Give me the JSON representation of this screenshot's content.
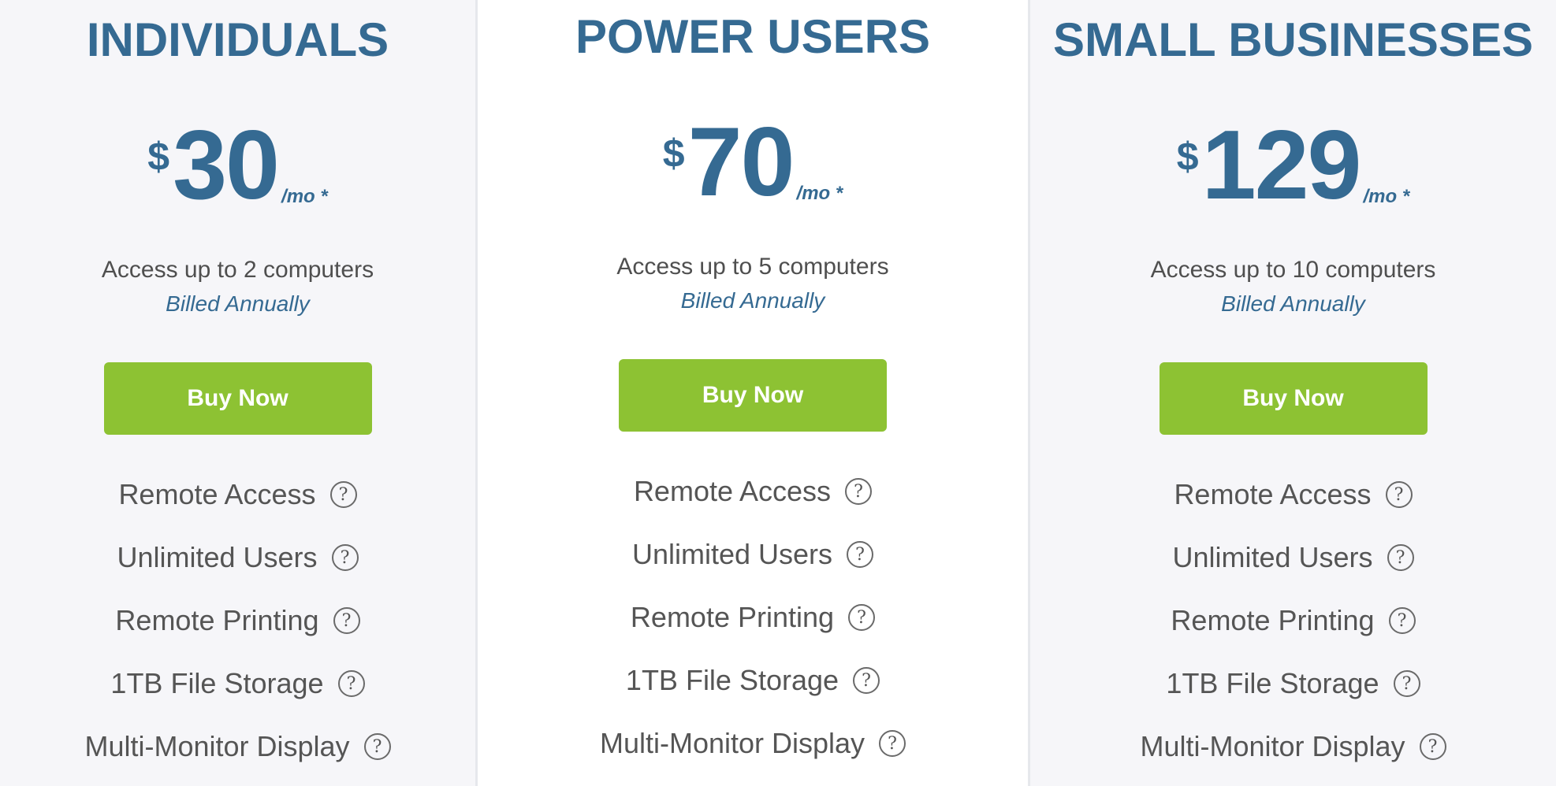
{
  "plans": [
    {
      "title": "INDIVIDUALS",
      "currency": "$",
      "amount": "30",
      "per": "/mo *",
      "access": "Access up to 2 computers",
      "billed": "Billed Annually",
      "button": "Buy Now",
      "features": [
        "Remote Access",
        "Unlimited Users",
        "Remote Printing",
        "1TB File Storage",
        "Multi-Monitor Display"
      ]
    },
    {
      "title": "POWER USERS",
      "currency": "$",
      "amount": "70",
      "per": "/mo *",
      "access": "Access up to 5 computers",
      "billed": "Billed Annually",
      "button": "Buy Now",
      "features": [
        "Remote Access",
        "Unlimited Users",
        "Remote Printing",
        "1TB File Storage",
        "Multi-Monitor Display"
      ]
    },
    {
      "title": "SMALL BUSINESSES",
      "currency": "$",
      "amount": "129",
      "per": "/mo *",
      "access": "Access up to 10 computers",
      "billed": "Billed Annually",
      "button": "Buy Now",
      "features": [
        "Remote Access",
        "Unlimited Users",
        "Remote Printing",
        "1TB File Storage",
        "Multi-Monitor Display"
      ]
    }
  ],
  "help_icon": "?",
  "colors": {
    "accent": "#356a92",
    "button": "#8dc233",
    "text": "#555555"
  }
}
